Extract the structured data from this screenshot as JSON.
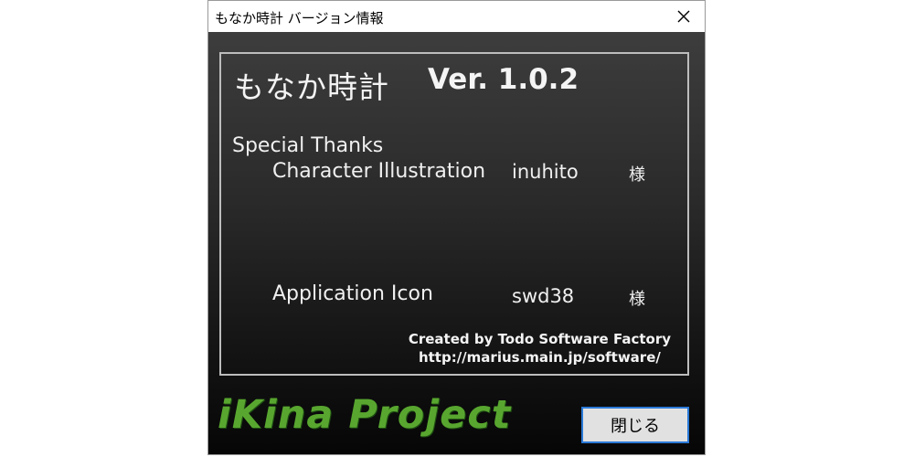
{
  "window": {
    "title": "もなか時計 バージョン情報",
    "close_icon": "close-icon"
  },
  "about": {
    "app_name": "もなか時計",
    "version": "Ver. 1.0.2",
    "special_thanks_heading": "Special Thanks",
    "credits": [
      {
        "role": "Character Illustration",
        "name": "inuhito",
        "honorific": "様"
      },
      {
        "role": "Application Icon",
        "name": "swd38",
        "honorific": "様"
      }
    ],
    "created_by": "Created by Todo Software Factory",
    "url": "http://marius.main.jp/software/"
  },
  "project_logo": "iKina Project",
  "close_button_label": "閉じる",
  "colors": {
    "logo_green": "#58a62f",
    "button_focus_border": "#2b79d6",
    "panel_border": "#bdbdbd"
  }
}
